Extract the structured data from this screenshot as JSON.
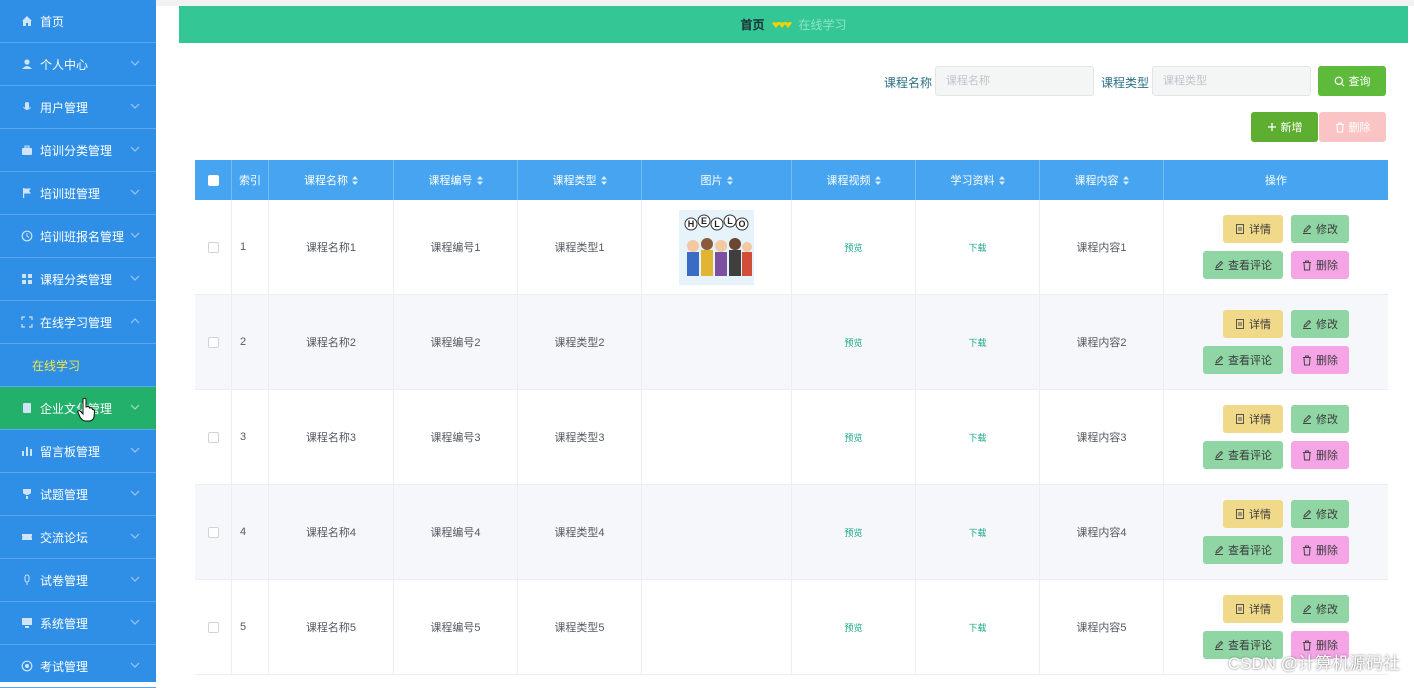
{
  "sidebar": {
    "items": [
      {
        "label": "首页",
        "icon": "home-icon"
      },
      {
        "label": "个人中心",
        "icon": "user-icon"
      },
      {
        "label": "用户管理",
        "icon": "mic-icon"
      },
      {
        "label": "培训分类管理",
        "icon": "briefcase-icon"
      },
      {
        "label": "培训班管理",
        "icon": "flag-icon"
      },
      {
        "label": "培训班报名管理",
        "icon": "clock-icon"
      },
      {
        "label": "课程分类管理",
        "icon": "grid-icon"
      },
      {
        "label": "在线学习管理",
        "icon": "fullscreen-icon"
      },
      {
        "label": "企业文化管理",
        "icon": "document-icon"
      },
      {
        "label": "留言板管理",
        "icon": "bar-chart-icon"
      },
      {
        "label": "试题管理",
        "icon": "trophy-icon"
      },
      {
        "label": "交流论坛",
        "icon": "ticket-icon"
      },
      {
        "label": "试卷管理",
        "icon": "microphone-icon"
      },
      {
        "label": "系统管理",
        "icon": "monitor-icon"
      },
      {
        "label": "考试管理",
        "icon": "circle-icon"
      }
    ],
    "submenu_label": "在线学习"
  },
  "breadcrumb": {
    "home": "首页",
    "current": "在线学习"
  },
  "search": {
    "name_label": "课程名称",
    "name_placeholder": "课程名称",
    "type_label": "课程类型",
    "type_placeholder": "课程类型",
    "query_label": "查询"
  },
  "actions": {
    "add_label": "新增",
    "delete_label": "删除"
  },
  "table": {
    "headers": [
      "索引",
      "课程名称",
      "课程编号",
      "课程类型",
      "图片",
      "课程视频",
      "学习资料",
      "课程内容",
      "操作"
    ],
    "preview_label": "预览",
    "download_label": "下载",
    "op_detail": "详情",
    "op_edit": "修改",
    "op_comment": "查看评论",
    "op_delete": "删除",
    "rows": [
      {
        "index": "1",
        "name": "课程名称1",
        "code": "课程编号1",
        "type": "课程类型1",
        "content": "课程内容1"
      },
      {
        "index": "2",
        "name": "课程名称2",
        "code": "课程编号2",
        "type": "课程类型2",
        "content": "课程内容2"
      },
      {
        "index": "3",
        "name": "课程名称3",
        "code": "课程编号3",
        "type": "课程类型3",
        "content": "课程内容3"
      },
      {
        "index": "4",
        "name": "课程名称4",
        "code": "课程编号4",
        "type": "课程类型4",
        "content": "课程内容4"
      },
      {
        "index": "5",
        "name": "课程名称5",
        "code": "课程编号5",
        "type": "课程类型5",
        "content": "课程内容5"
      }
    ],
    "image_text": "HELLO"
  },
  "watermark": "CSDN @计算机源码社",
  "colors": {
    "sidebar": "#2f8fe6",
    "sidebar_active": "#22b06a",
    "breadcrumb": "#34c795",
    "table_header": "#46a4f0"
  }
}
